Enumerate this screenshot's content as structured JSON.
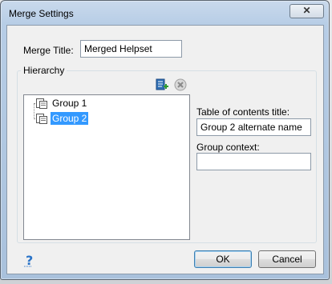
{
  "window": {
    "title": "Merge Settings",
    "close_label": "✕"
  },
  "merge": {
    "label": "Merge Title:",
    "value": "Merged Helpset"
  },
  "hierarchy": {
    "group_label": "Hierarchy",
    "toolbar": {
      "add_icon": "add-group-icon",
      "remove_icon": "remove-icon"
    },
    "tree": [
      {
        "label": "Group 1",
        "selected": false
      },
      {
        "label": "Group 2",
        "selected": true
      }
    ]
  },
  "details": {
    "toc_label": "Table of contents title:",
    "toc_value": "Group 2 alternate name",
    "context_label": "Group context:",
    "context_value": ""
  },
  "footer": {
    "help_icon": "help-icon",
    "ok_label": "OK",
    "cancel_label": "Cancel"
  },
  "colors": {
    "selection": "#3399ff",
    "accent": "#3c7fb1"
  }
}
